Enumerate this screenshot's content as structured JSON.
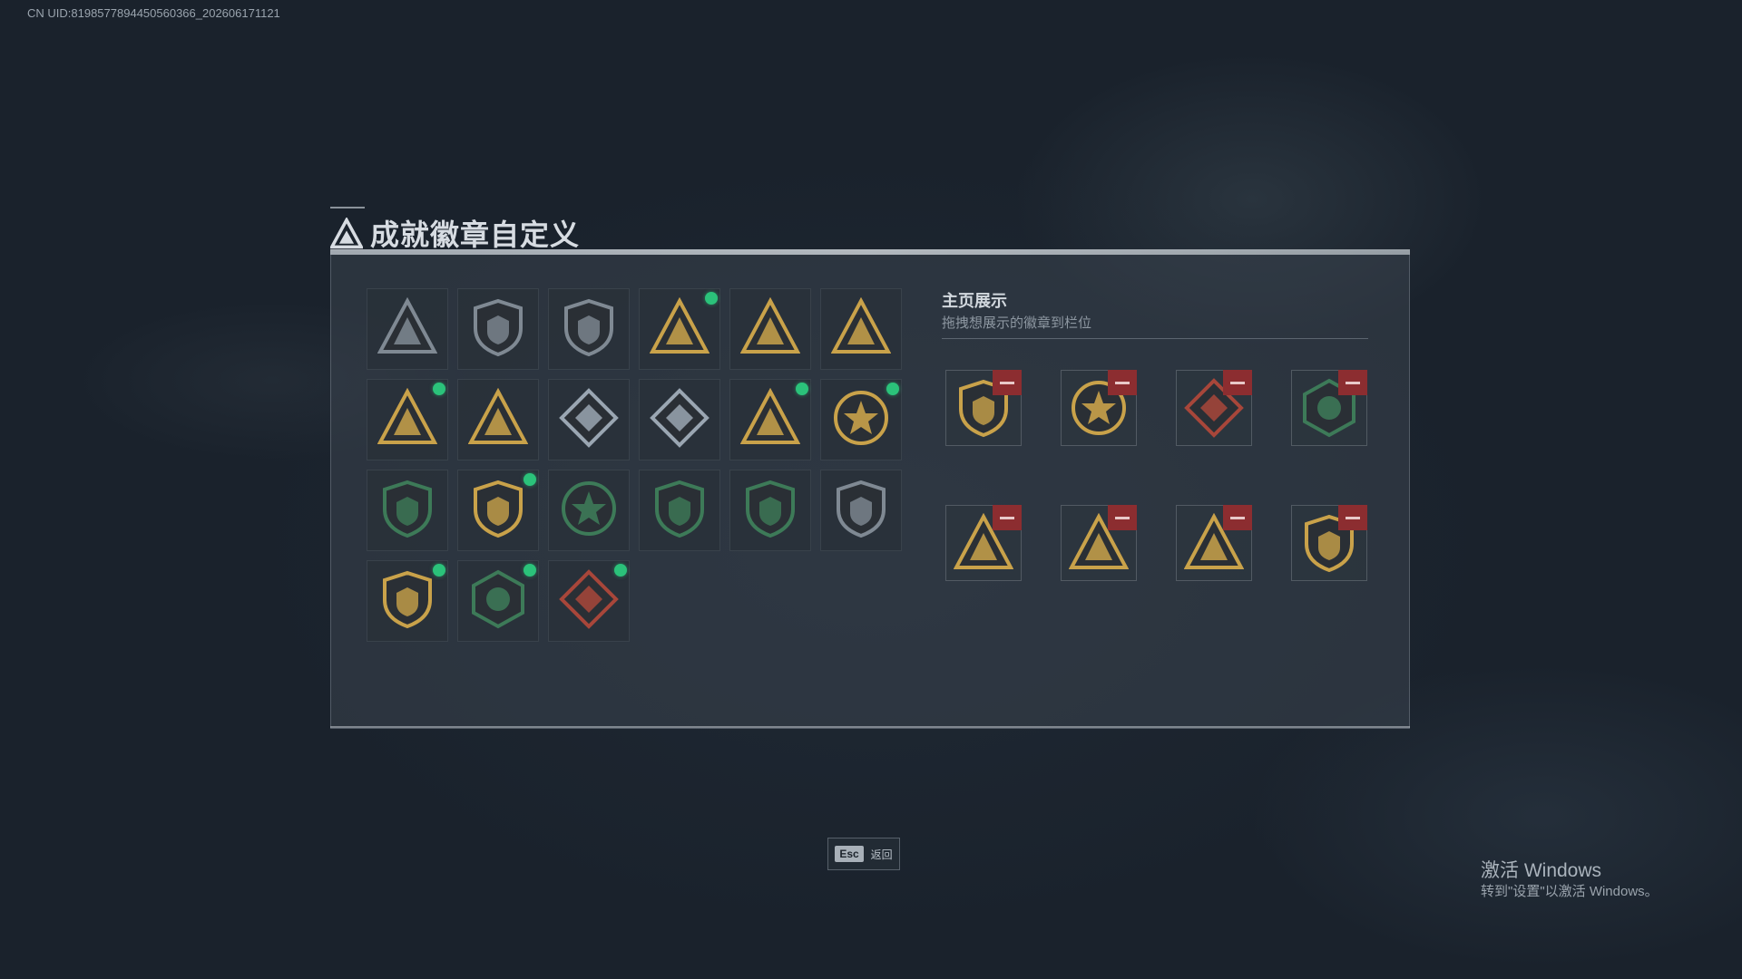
{
  "uid_text": "CN UID:8198577894450560366_202606171121",
  "header": {
    "title": "成就徽章自定义",
    "icon": "triangle-logo-icon"
  },
  "badges": [
    {
      "icon": "shield-triangle-badge-icon",
      "theme": "grey",
      "dot": false
    },
    {
      "icon": "helicopter-badge-icon",
      "theme": "grey",
      "dot": false
    },
    {
      "icon": "jet-shield-badge-icon",
      "theme": "grey",
      "dot": false
    },
    {
      "icon": "rock-hand-triangle-badge-icon",
      "theme": "gold",
      "dot": true
    },
    {
      "icon": "helmet-triangle-badge-icon",
      "theme": "gold",
      "dot": false
    },
    {
      "icon": "number-one-triangle-badge-icon",
      "theme": "gold",
      "dot": false
    },
    {
      "icon": "soldier-triangle-badge-icon",
      "theme": "gold",
      "dot": true
    },
    {
      "icon": "squad-triangle-badge-icon",
      "theme": "gold",
      "dot": false
    },
    {
      "icon": "crystal-diamond-badge-icon",
      "theme": "silver",
      "dot": false
    },
    {
      "icon": "rifle-diamond-badge-icon",
      "theme": "silver",
      "dot": false
    },
    {
      "icon": "knife-triangle-badge-icon",
      "theme": "gold",
      "dot": true
    },
    {
      "icon": "star-emblem-badge-icon",
      "theme": "gold",
      "dot": true
    },
    {
      "icon": "green-shield-badge-icon",
      "theme": "green",
      "dot": false
    },
    {
      "icon": "lion-shield-badge-icon",
      "theme": "gold",
      "dot": true
    },
    {
      "icon": "skull-emblem-badge-icon",
      "theme": "green",
      "dot": false
    },
    {
      "icon": "crosshair-shield-badge-icon",
      "theme": "green",
      "dot": false
    },
    {
      "icon": "crosshair-wing-badge-icon",
      "theme": "green",
      "dot": false
    },
    {
      "icon": "no-gun-shield-badge-icon",
      "theme": "grey",
      "dot": false
    },
    {
      "icon": "anchor-shield-badge-icon",
      "theme": "gold",
      "dot": true
    },
    {
      "icon": "hornet-hexagon-badge-icon",
      "theme": "green",
      "dot": true
    },
    {
      "icon": "dragon-diamond-badge-icon",
      "theme": "red",
      "dot": true
    }
  ],
  "showcase": {
    "title": "主页展示",
    "subtitle": "拖拽想展示的徽章到栏位",
    "slots": [
      {
        "icon": "anchor-shield-badge-icon",
        "theme": "gold"
      },
      {
        "icon": "star-emblem-badge-icon",
        "theme": "gold"
      },
      {
        "icon": "dragon-diamond-badge-icon",
        "theme": "red"
      },
      {
        "icon": "hornet-hexagon-badge-icon",
        "theme": "green"
      },
      {
        "icon": "soldier-triangle-badge-icon",
        "theme": "gold"
      },
      {
        "icon": "knife-triangle-badge-icon",
        "theme": "gold"
      },
      {
        "icon": "rock-hand-triangle-badge-icon",
        "theme": "gold"
      },
      {
        "icon": "lion-shield-badge-icon",
        "theme": "gold"
      }
    ]
  },
  "footer": {
    "esc_key": "Esc",
    "esc_label": "返回"
  },
  "watermark": {
    "title": "激活 Windows",
    "subtitle": "转到\"设置\"以激活 Windows。"
  },
  "colors": {
    "gold": "#c9a24a",
    "silver": "#9aa6b2",
    "green": "#3d7a58",
    "red": "#a8463a",
    "grey": "#7f8993",
    "dot": "#2bc27a",
    "remove": "#8c2d30"
  }
}
